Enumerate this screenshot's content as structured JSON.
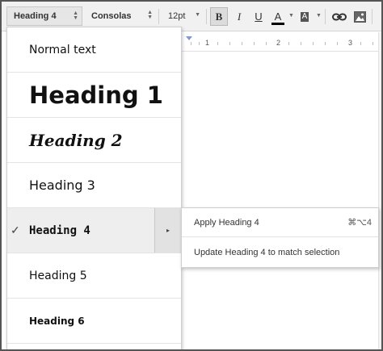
{
  "toolbar": {
    "style_select": "Heading 4",
    "font_select": "Consolas",
    "size_select": "12pt",
    "bold_label": "B",
    "italic_label": "I",
    "underline_label": "U",
    "text_color_label": "A",
    "highlight_label": "A",
    "text_color_bar": "#000000"
  },
  "ruler": {
    "marks": [
      "1",
      "2",
      "3"
    ]
  },
  "style_menu": {
    "items": [
      {
        "label": "Normal text",
        "selected": false
      },
      {
        "label": "Heading 1",
        "selected": false
      },
      {
        "label": "Heading 2",
        "selected": false
      },
      {
        "label": "Heading 3",
        "selected": false
      },
      {
        "label": "Heading 4",
        "selected": true
      },
      {
        "label": "Heading 5",
        "selected": false
      },
      {
        "label": "Heading 6",
        "selected": false
      }
    ],
    "check_mark": "✓",
    "submenu_arrow": "▸"
  },
  "submenu": {
    "apply_label": "Apply Heading 4",
    "apply_shortcut": "⌘⌥4",
    "update_label": "Update Heading 4 to match selection"
  },
  "icons": {
    "link": "link-icon",
    "image": "image-icon",
    "check": "check-icon",
    "submenu": "submenu-arrow-icon"
  },
  "colors": {
    "menu_selected_bg": "#eeeeee",
    "toolbar_bg": "#f1f1f1",
    "ruler_indent": "#7d9ad6"
  }
}
